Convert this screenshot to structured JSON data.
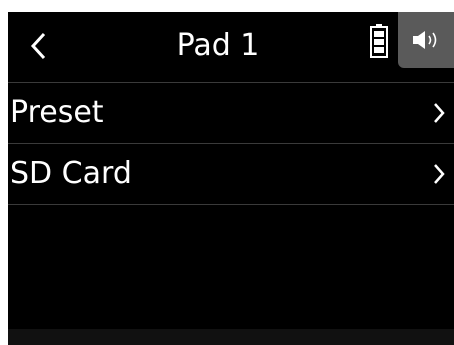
{
  "header": {
    "title": "Pad 1",
    "back_icon": "chevron-left-icon",
    "battery_icon": "battery-icon",
    "speaker_icon": "speaker-icon"
  },
  "menu": {
    "items": [
      {
        "label": "Preset",
        "icon": "chevron-right-icon"
      },
      {
        "label": "SD Card",
        "icon": "chevron-right-icon"
      }
    ]
  },
  "colors": {
    "background": "#000000",
    "text": "#ffffff",
    "divider": "#3a3a3a",
    "tab": "#5a5a5a"
  }
}
